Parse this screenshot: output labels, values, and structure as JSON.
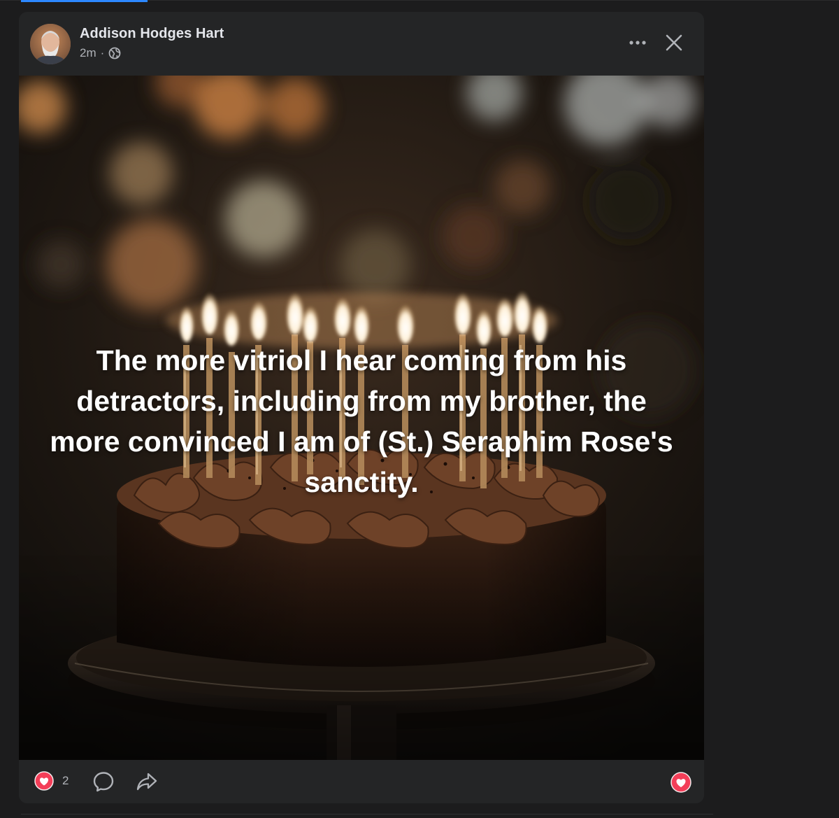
{
  "post": {
    "author": "Addison Hodges Hart",
    "timestamp": "2m",
    "separator": "·",
    "privacy_icon": "globe-icon",
    "caption": "The more vitriol I hear coming from his detractors, including from my brother, the more convinced I am of (St.) Seraphim Rose's sanctity."
  },
  "reactions": {
    "icon": "heart-icon",
    "count": "2"
  },
  "colors": {
    "card_bg": "#242526",
    "page_bg": "#1c1c1d",
    "text_primary": "#e4e6eb",
    "text_secondary": "#b0b3b8",
    "love_red": "#f33e58",
    "accent_blue": "#2d88ff"
  }
}
